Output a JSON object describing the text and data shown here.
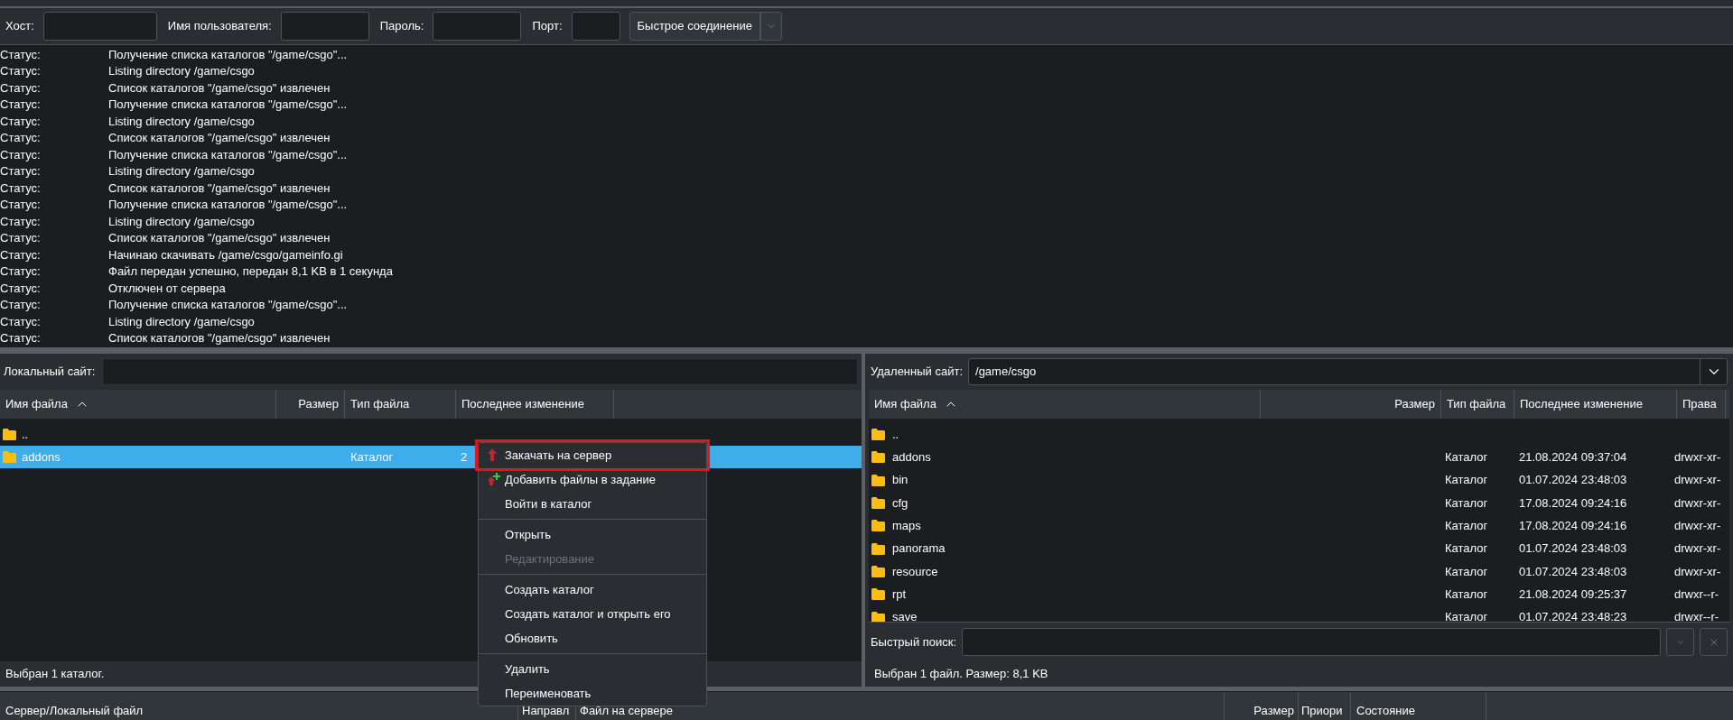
{
  "quickconnect": {
    "fields": [
      {
        "label": "Хост:"
      },
      {
        "label": "Имя пользователя:"
      },
      {
        "label": "Пароль:"
      },
      {
        "label": "Порт:"
      }
    ],
    "button": "Быстрое соединение"
  },
  "log": [
    {
      "label": "Статус:",
      "message": "Получение списка каталогов \"/game/csgo\"..."
    },
    {
      "label": "Статус:",
      "message": "Listing directory /game/csgo"
    },
    {
      "label": "Статус:",
      "message": "Список каталогов \"/game/csgo\" извлечен"
    },
    {
      "label": "Статус:",
      "message": "Получение списка каталогов \"/game/csgo\"..."
    },
    {
      "label": "Статус:",
      "message": "Listing directory /game/csgo"
    },
    {
      "label": "Статус:",
      "message": "Список каталогов \"/game/csgo\" извлечен"
    },
    {
      "label": "Статус:",
      "message": "Получение списка каталогов \"/game/csgo\"..."
    },
    {
      "label": "Статус:",
      "message": "Listing directory /game/csgo"
    },
    {
      "label": "Статус:",
      "message": "Список каталогов \"/game/csgo\" извлечен"
    },
    {
      "label": "Статус:",
      "message": "Получение списка каталогов \"/game/csgo\"..."
    },
    {
      "label": "Статус:",
      "message": "Listing directory /game/csgo"
    },
    {
      "label": "Статус:",
      "message": "Список каталогов \"/game/csgo\" извлечен"
    },
    {
      "label": "Статус:",
      "message": "Начинаю скачивать /game/csgo/gameinfo.gi"
    },
    {
      "label": "Статус:",
      "message": "Файл передан успешно, передан 8,1 KB в 1 секунда"
    },
    {
      "label": "Статус:",
      "message": "Отключен от сервера"
    },
    {
      "label": "Статус:",
      "message": "Получение списка каталогов \"/game/csgo\"..."
    },
    {
      "label": "Статус:",
      "message": "Listing directory /game/csgo"
    },
    {
      "label": "Статус:",
      "message": "Список каталогов \"/game/csgo\" извлечен"
    }
  ],
  "local": {
    "site_label": "Локальный сайт:",
    "columns": [
      "Имя файла",
      "Размер",
      "Тип файла",
      "Последнее изменение"
    ],
    "rows": [
      {
        "name": "..",
        "type": "",
        "modified": "",
        "selected": false
      },
      {
        "name": "addons",
        "type": "Каталог",
        "modified": "2",
        "selected": true
      }
    ],
    "status": "Выбран 1 каталог."
  },
  "remote": {
    "site_label": "Удаленный сайт:",
    "path": "/game/csgo",
    "columns": [
      "Имя файла",
      "Размер",
      "Тип файла",
      "Последнее изменение",
      "Права"
    ],
    "rows": [
      {
        "name": "..",
        "type": "",
        "modified": "",
        "perms": "",
        "selected": false
      },
      {
        "name": "addons",
        "type": "Каталог",
        "modified": "21.08.2024 09:37:04",
        "perms": "drwxr-xr-",
        "selected": false
      },
      {
        "name": "bin",
        "type": "Каталог",
        "modified": "01.07.2024 23:48:03",
        "perms": "drwxr-xr-",
        "selected": false
      },
      {
        "name": "cfg",
        "type": "Каталог",
        "modified": "17.08.2024 09:24:16",
        "perms": "drwxr-xr-",
        "selected": false
      },
      {
        "name": "maps",
        "type": "Каталог",
        "modified": "17.08.2024 09:24:16",
        "perms": "drwxr-xr-",
        "selected": false
      },
      {
        "name": "panorama",
        "type": "Каталог",
        "modified": "01.07.2024 23:48:03",
        "perms": "drwxr-xr-",
        "selected": false
      },
      {
        "name": "resource",
        "type": "Каталог",
        "modified": "01.07.2024 23:48:03",
        "perms": "drwxr-xr-",
        "selected": false
      },
      {
        "name": "rpt",
        "type": "Каталог",
        "modified": "21.08.2024 09:25:37",
        "perms": "drwxr--r-",
        "selected": false
      },
      {
        "name": "save",
        "type": "Каталог",
        "modified": "01.07.2024 23:48:23",
        "perms": "drwxr--r-",
        "selected": false
      }
    ],
    "search_label": "Быстрый поиск:",
    "status": "Выбран 1 файл. Размер: 8,1 KB"
  },
  "context_menu": [
    [
      {
        "kind": "upload",
        "label": "Закачать на сервер",
        "disabled": false,
        "annotated": true
      },
      {
        "kind": "enqueue",
        "label": "Добавить файлы в задание",
        "disabled": false,
        "annotated": false
      },
      {
        "kind": "plain",
        "label": "Войти в каталог",
        "disabled": false,
        "annotated": false
      }
    ],
    [
      {
        "kind": "plain",
        "label": "Открыть",
        "disabled": false,
        "annotated": false
      },
      {
        "kind": "plain",
        "label": "Редактирование",
        "disabled": true,
        "annotated": false
      }
    ],
    [
      {
        "kind": "plain",
        "label": "Создать каталог",
        "disabled": false,
        "annotated": false
      },
      {
        "kind": "plain",
        "label": "Создать каталог и открыть его",
        "disabled": false,
        "annotated": false
      },
      {
        "kind": "plain",
        "label": "Обновить",
        "disabled": false,
        "annotated": false
      }
    ],
    [
      {
        "kind": "plain",
        "label": "Удалить",
        "disabled": false,
        "annotated": false
      },
      {
        "kind": "plain",
        "label": "Переименовать",
        "disabled": false,
        "annotated": false
      }
    ]
  ],
  "queue": {
    "columns": [
      "Сервер/Локальный файл",
      "Направл",
      "Файл на сервере",
      "Размер",
      "Приори",
      "Состояние"
    ]
  }
}
